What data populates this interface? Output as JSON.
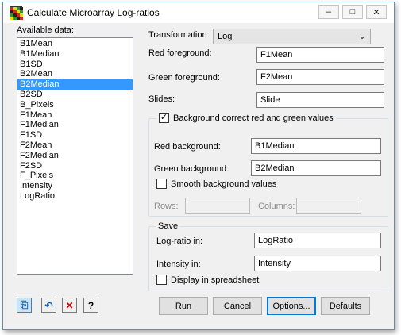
{
  "window": {
    "title": "Calculate Microarray Log-ratios",
    "minimize_glyph": "–",
    "maximize_glyph": "□",
    "close_glyph": "✕"
  },
  "available_data": {
    "label": "Available data:",
    "items": [
      "B1Mean",
      "B1Median",
      "B1SD",
      "B2Mean",
      "B2Median",
      "B2SD",
      "B_Pixels",
      "F1Mean",
      "F1Median",
      "F1SD",
      "F2Mean",
      "F2Median",
      "F2SD",
      "F_Pixels",
      "Intensity",
      "LogRatio"
    ],
    "selected": "B2Median"
  },
  "transformation": {
    "label": "Transformation:",
    "value": "Log",
    "arrow": "⌄"
  },
  "red_foreground": {
    "label": "Red foreground:",
    "value": "F1Mean"
  },
  "green_foreground": {
    "label": "Green foreground:",
    "value": "F2Mean"
  },
  "slides": {
    "label": "Slides:",
    "value": "Slide"
  },
  "background_correct": {
    "label": "Background correct red and green values",
    "checked": true,
    "check_glyph": "✓"
  },
  "red_background": {
    "label": "Red background:",
    "value": "B1Median"
  },
  "green_background": {
    "label": "Green background:",
    "value": "B2Median"
  },
  "smooth_background": {
    "label": "Smooth background values",
    "checked": false
  },
  "rows": {
    "label": "Rows:",
    "value": ""
  },
  "columns": {
    "label": "Columns:",
    "value": ""
  },
  "save": {
    "label": "Save",
    "log_ratio": {
      "label": "Log-ratio in:",
      "value": "LogRatio"
    },
    "intensity": {
      "label": "Intensity in:",
      "value": "Intensity"
    },
    "display_spreadsheet": {
      "label": "Display in spreadsheet",
      "checked": false
    }
  },
  "buttons": {
    "run": "Run",
    "cancel": "Cancel",
    "options": "Options...",
    "defaults": "Defaults"
  },
  "tool_icons": {
    "copy": {
      "glyph": "⎘"
    },
    "undo": {
      "glyph": "↶"
    },
    "clear": {
      "glyph": "✕"
    },
    "help": {
      "glyph": "?"
    }
  },
  "colors": {
    "selection": "#3399ff",
    "clear_icon": "#c00000",
    "undo_icon": "#1a5fb4"
  }
}
